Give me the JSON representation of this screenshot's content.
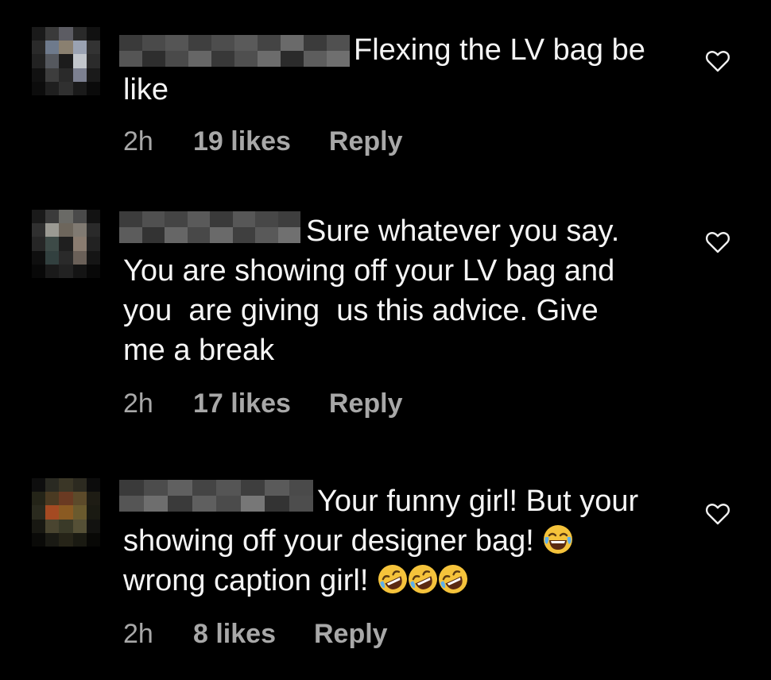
{
  "colors": {
    "background": "#000000",
    "text": "#f5f5f5",
    "meta_text": "#a8a8a8",
    "emoji_face": "#f5c33b"
  },
  "comments": [
    {
      "text_lead": "Flexing the LV bag be",
      "text_rest": "like",
      "time": "2h",
      "likes": "19 likes",
      "reply_label": "Reply",
      "heart_icon": "heart-outline-icon",
      "emojis": []
    },
    {
      "text_lead": "Sure whatever you say.",
      "text_rest": "You are showing off your LV bag and\nyou  are giving  us this advice. Give\nme a break",
      "time": "2h",
      "likes": "17 likes",
      "reply_label": "Reply",
      "heart_icon": "heart-outline-icon",
      "emojis": []
    },
    {
      "text_lead": "Your funny girl! But your",
      "text_rest_line1": "showing off your designer bag!",
      "text_rest_line2": "wrong caption girl!",
      "time": "2h",
      "likes": "8 likes",
      "reply_label": "Reply",
      "heart_icon": "heart-outline-icon",
      "emojis": [
        "face-with-tears-of-joy",
        "rolling-on-the-floor-laughing",
        "rolling-on-the-floor-laughing",
        "rolling-on-the-floor-laughing"
      ]
    }
  ]
}
